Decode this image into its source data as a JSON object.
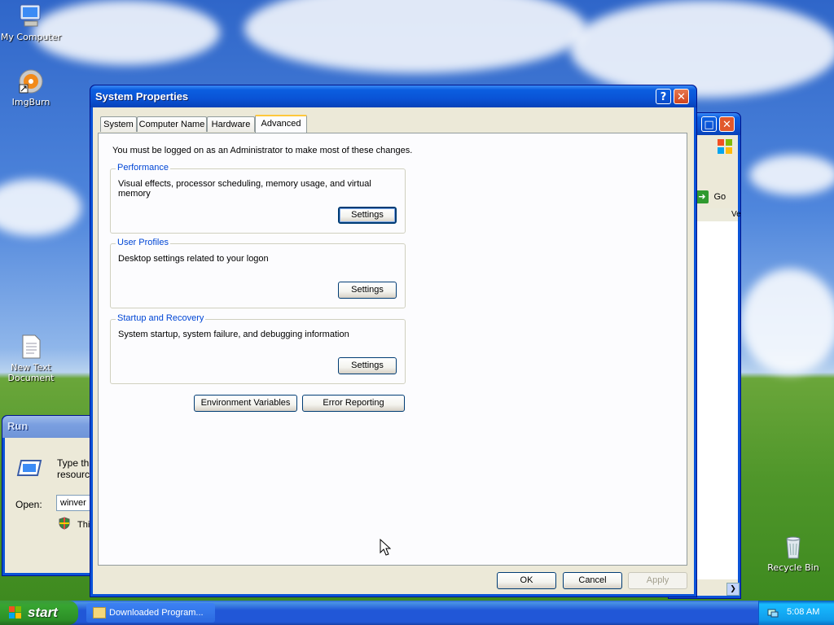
{
  "desktop": {
    "icons": [
      {
        "label": "My Computer",
        "icon": "my-computer-icon"
      },
      {
        "label": "ImgBurn",
        "icon": "imgburn-icon"
      },
      {
        "label": "New Text Document",
        "icon": "text-document-icon"
      },
      {
        "label": "Recycle Bin",
        "icon": "recycle-bin-icon"
      }
    ]
  },
  "background_window": {
    "go_label": "Go",
    "column_fragment": "Ve"
  },
  "run_dialog": {
    "title": "Run",
    "desc_line1": "Type th",
    "desc_line2": "resourc",
    "open_label": "Open:",
    "open_value": "winver",
    "note_fragment": "Thi"
  },
  "system_properties": {
    "title": "System Properties",
    "help_glyph": "?",
    "close_glyph": "✕",
    "tabs": [
      {
        "label": "System",
        "active": false
      },
      {
        "label": "Computer Name",
        "active": false
      },
      {
        "label": "Hardware",
        "active": false
      },
      {
        "label": "Advanced",
        "active": true
      }
    ],
    "admin_note": "You must be logged on as an Administrator to make most of these changes.",
    "groups": [
      {
        "title": "Performance",
        "description": "Visual effects, processor scheduling, memory usage, and virtual memory",
        "button": "Settings"
      },
      {
        "title": "User Profiles",
        "description": "Desktop settings related to your logon",
        "button": "Settings"
      },
      {
        "title": "Startup and Recovery",
        "description": "System startup, system failure, and debugging information",
        "button": "Settings"
      }
    ],
    "env_button": "Environment Variables",
    "error_button": "Error Reporting",
    "ok_button": "OK",
    "cancel_button": "Cancel",
    "apply_button": "Apply"
  },
  "taskbar": {
    "start_label": "start",
    "task_label": "Downloaded Program...",
    "clock": "5:08 AM"
  },
  "colors": {
    "title_blue": "#0a53d6",
    "dialog_face": "#ece9d8",
    "group_title": "#0046d5",
    "start_green": "#37a531"
  }
}
